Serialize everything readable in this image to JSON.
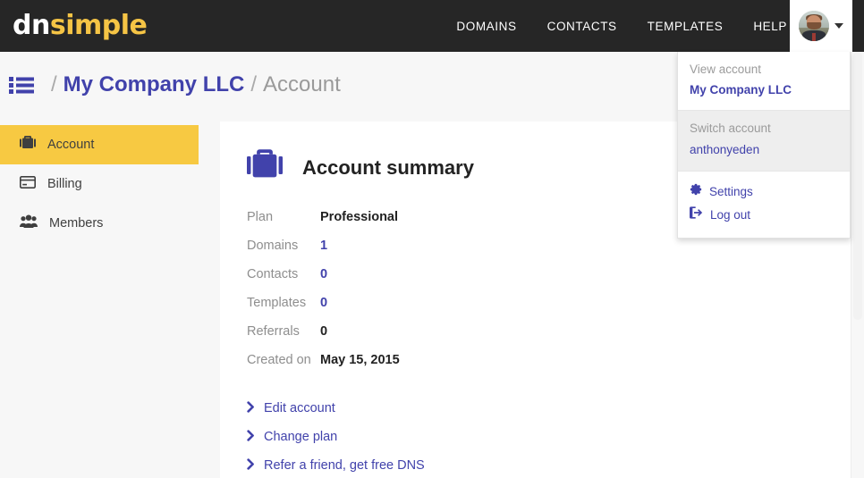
{
  "brand": {
    "logo_first": "dn",
    "logo_second": "simple",
    "accent_yellow": "#f5c445",
    "accent_blue": "#4142ab",
    "topbar_bg": "#262626"
  },
  "topnav": {
    "items": [
      {
        "label": "DOMAINS"
      },
      {
        "label": "CONTACTS"
      },
      {
        "label": "TEMPLATES"
      },
      {
        "label": "HELP"
      }
    ],
    "avatar_icon": "user-avatar",
    "caret_icon": "chevron-down-icon"
  },
  "account_menu": {
    "view_account_label": "View account",
    "current_account": "My Company LLC",
    "switch_account_label": "Switch account",
    "other_accounts": [
      {
        "label": "anthonyeden"
      }
    ],
    "settings_label": "Settings",
    "settings_icon": "gear-icon",
    "logout_label": "Log out",
    "logout_icon": "sign-out-icon"
  },
  "breadcrumb": {
    "menu_icon": "list-icon",
    "separator": "/",
    "account_link": "My Company LLC",
    "current_page": "Account"
  },
  "sidebar": {
    "items": [
      {
        "label": "Account",
        "icon": "briefcase-icon",
        "active": true
      },
      {
        "label": "Billing",
        "icon": "credit-card-icon",
        "active": false
      },
      {
        "label": "Members",
        "icon": "users-icon",
        "active": false
      }
    ]
  },
  "main": {
    "card_icon": "briefcase-icon",
    "card_title": "Account summary",
    "summary": [
      {
        "label": "Plan",
        "value": "Professional",
        "is_link": false
      },
      {
        "label": "Domains",
        "value": "1",
        "is_link": true
      },
      {
        "label": "Contacts",
        "value": "0",
        "is_link": true
      },
      {
        "label": "Templates",
        "value": "0",
        "is_link": true
      },
      {
        "label": "Referrals",
        "value": "0",
        "is_link": false
      },
      {
        "label": "Created on",
        "value": "May 15, 2015",
        "is_link": false
      }
    ],
    "actions": [
      {
        "label": "Edit account",
        "icon": "chevron-right-icon"
      },
      {
        "label": "Change plan",
        "icon": "chevron-right-icon"
      },
      {
        "label": "Refer a friend, get free DNS",
        "icon": "chevron-right-icon"
      }
    ]
  }
}
